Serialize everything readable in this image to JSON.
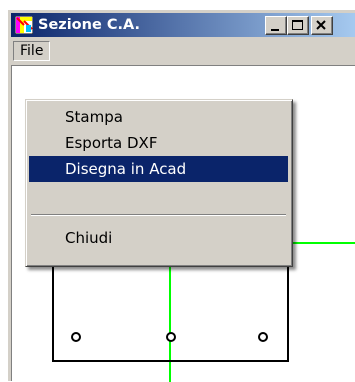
{
  "window": {
    "title": "Sezione C.A.",
    "controls": [
      "minimize",
      "maximize",
      "close"
    ]
  },
  "menubar": {
    "items": [
      {
        "label": "File"
      }
    ]
  },
  "file_menu": {
    "items": [
      {
        "label": "Stampa",
        "highlighted": false
      },
      {
        "label": "Esporta DXF",
        "highlighted": false
      },
      {
        "label": "Disegna in Acad",
        "highlighted": true
      },
      {
        "label": "Chiudi",
        "highlighted": false
      }
    ]
  },
  "colors": {
    "title_bar": "#0a246a",
    "menu_highlight": "#0a246a",
    "axis_lines": "#00ff00",
    "section_outline": "#000000"
  },
  "drawing": {
    "rebars_visible": 3
  }
}
